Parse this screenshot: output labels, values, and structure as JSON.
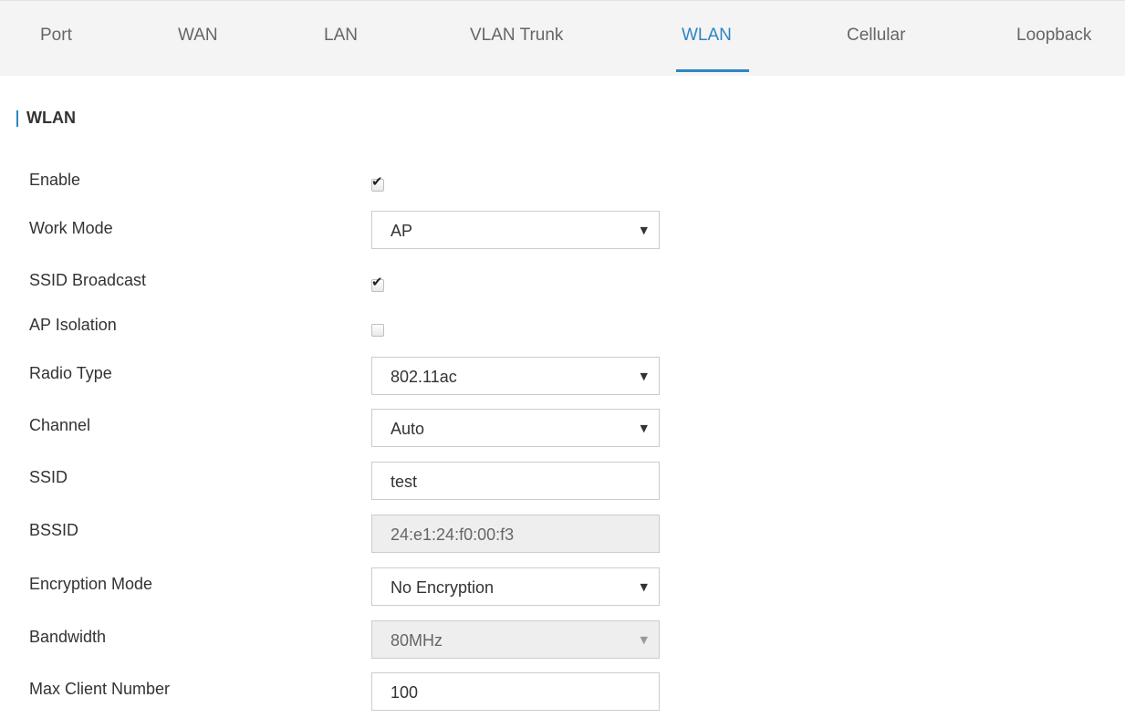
{
  "tabs": [
    {
      "label": "Port"
    },
    {
      "label": "WAN"
    },
    {
      "label": "LAN"
    },
    {
      "label": "VLAN Trunk"
    },
    {
      "label": "WLAN"
    },
    {
      "label": "Cellular"
    },
    {
      "label": "Loopback"
    }
  ],
  "active_tab": "WLAN",
  "section": {
    "title": "WLAN"
  },
  "form": {
    "enable": {
      "label": "Enable",
      "checked": true
    },
    "work_mode": {
      "label": "Work Mode",
      "value": "AP"
    },
    "ssid_broadcast": {
      "label": "SSID Broadcast",
      "checked": true
    },
    "ap_isolation": {
      "label": "AP Isolation",
      "checked": false
    },
    "radio_type": {
      "label": "Radio Type",
      "value": "802.11ac"
    },
    "channel": {
      "label": "Channel",
      "value": "Auto"
    },
    "ssid": {
      "label": "SSID",
      "value": "test"
    },
    "bssid": {
      "label": "BSSID",
      "value": "24:e1:24:f0:00:f3"
    },
    "encryption_mode": {
      "label": "Encryption Mode",
      "value": "No Encryption"
    },
    "bandwidth": {
      "label": "Bandwidth",
      "value": "80MHz"
    },
    "max_client_number": {
      "label": "Max Client Number",
      "value": "100"
    }
  },
  "icons": {
    "check": "✔",
    "caret": "▼"
  },
  "colors": {
    "accent": "#2e86c1",
    "tabbar_bg": "#f4f4f4",
    "disabled_bg": "#eeeeee"
  }
}
